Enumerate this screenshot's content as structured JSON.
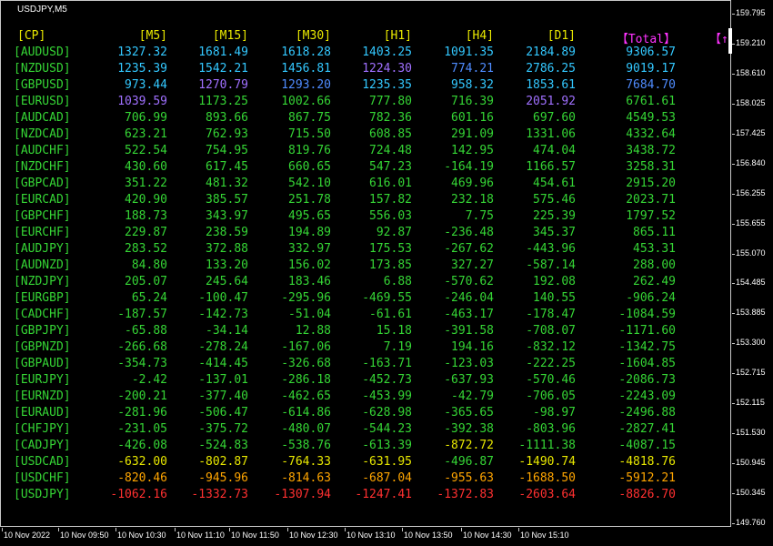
{
  "chart": {
    "title": "USDJPY,M5",
    "price_axis": [
      "159.795",
      "159.210",
      "158.610",
      "158.025",
      "157.425",
      "156.840",
      "156.255",
      "155.655",
      "155.070",
      "154.485",
      "153.885",
      "153.300",
      "152.715",
      "152.115",
      "151.530",
      "150.945",
      "150.345",
      "149.760"
    ],
    "time_axis": [
      "10 Nov 2022",
      "10 Nov 09:50",
      "10 Nov 10:30",
      "10 Nov 11:10",
      "10 Nov 11:50",
      "10 Nov 12:30",
      "10 Nov 13:10",
      "10 Nov 13:50",
      "10 Nov 14:30",
      "10 Nov 15:10"
    ]
  },
  "table": {
    "headers": [
      "[CP]",
      "[M5]",
      "[M15]",
      "[M30]",
      "[H1]",
      "[H4]",
      "[D1]",
      "【Total】",
      "【↑"
    ],
    "header_colors": [
      "#e8e800",
      "#e8e800",
      "#e8e800",
      "#e8e800",
      "#e8e800",
      "#e8e800",
      "#e8e800",
      "#ff33ff",
      "#ff33ff"
    ],
    "rows": [
      {
        "pair": "[AUDUSD]",
        "values": [
          "1327.32",
          "1681.49",
          "1618.28",
          "1403.25",
          "1091.35",
          "2184.89",
          "9306.57"
        ],
        "colors": [
          "#33c8ff",
          "#33c8ff",
          "#33c8ff",
          "#33c8ff",
          "#33c8ff",
          "#33c8ff",
          "#33c8ff"
        ]
      },
      {
        "pair": "[NZDUSD]",
        "values": [
          "1235.39",
          "1542.21",
          "1456.81",
          "1224.30",
          "774.21",
          "2786.25",
          "9019.17"
        ],
        "colors": [
          "#33c8ff",
          "#33c8ff",
          "#33c8ff",
          "#a070ff",
          "#4f8cff",
          "#33c8ff",
          "#33c8ff"
        ]
      },
      {
        "pair": "[GBPUSD]",
        "values": [
          "973.44",
          "1270.79",
          "1293.20",
          "1235.35",
          "958.32",
          "1853.61",
          "7684.70"
        ],
        "colors": [
          "#33c8ff",
          "#a070ff",
          "#4f8cff",
          "#33c8ff",
          "#33c8ff",
          "#33c8ff",
          "#4f8cff"
        ]
      },
      {
        "pair": "[EURUSD]",
        "values": [
          "1039.59",
          "1173.25",
          "1002.66",
          "777.80",
          "716.39",
          "2051.92",
          "6761.61"
        ],
        "colors": [
          "#a070ff",
          "#35d535",
          "#35d535",
          "#35d535",
          "#35d535",
          "#a070ff",
          "#35d535"
        ]
      },
      {
        "pair": "[AUDCAD]",
        "values": [
          "706.99",
          "893.66",
          "867.75",
          "782.36",
          "601.16",
          "697.60",
          "4549.53"
        ],
        "colors": [
          "#35d535",
          "#35d535",
          "#35d535",
          "#35d535",
          "#35d535",
          "#35d535",
          "#35d535"
        ]
      },
      {
        "pair": "[NZDCAD]",
        "values": [
          "623.21",
          "762.93",
          "715.50",
          "608.85",
          "291.09",
          "1331.06",
          "4332.64"
        ],
        "colors": [
          "#35d535",
          "#35d535",
          "#35d535",
          "#35d535",
          "#35d535",
          "#35d535",
          "#35d535"
        ]
      },
      {
        "pair": "[AUDCHF]",
        "values": [
          "522.54",
          "754.95",
          "819.76",
          "724.48",
          "142.95",
          "474.04",
          "3438.72"
        ],
        "colors": [
          "#35d535",
          "#35d535",
          "#35d535",
          "#35d535",
          "#35d535",
          "#35d535",
          "#35d535"
        ]
      },
      {
        "pair": "[NZDCHF]",
        "values": [
          "430.60",
          "617.45",
          "660.65",
          "547.23",
          "-164.19",
          "1166.57",
          "3258.31"
        ],
        "colors": [
          "#35d535",
          "#35d535",
          "#35d535",
          "#35d535",
          "#35d535",
          "#35d535",
          "#35d535"
        ]
      },
      {
        "pair": "[GBPCAD]",
        "values": [
          "351.22",
          "481.32",
          "542.10",
          "616.01",
          "469.96",
          "454.61",
          "2915.20"
        ],
        "colors": [
          "#35d535",
          "#35d535",
          "#35d535",
          "#35d535",
          "#35d535",
          "#35d535",
          "#35d535"
        ]
      },
      {
        "pair": "[EURCAD]",
        "values": [
          "420.90",
          "385.57",
          "251.78",
          "157.82",
          "232.18",
          "575.46",
          "2023.71"
        ],
        "colors": [
          "#35d535",
          "#35d535",
          "#35d535",
          "#35d535",
          "#35d535",
          "#35d535",
          "#35d535"
        ]
      },
      {
        "pair": "[GBPCHF]",
        "values": [
          "188.73",
          "343.97",
          "495.65",
          "556.03",
          "7.75",
          "225.39",
          "1797.52"
        ],
        "colors": [
          "#35d535",
          "#35d535",
          "#35d535",
          "#35d535",
          "#35d535",
          "#35d535",
          "#35d535"
        ]
      },
      {
        "pair": "[EURCHF]",
        "values": [
          "229.87",
          "238.59",
          "194.89",
          "92.87",
          "-236.48",
          "345.37",
          "865.11"
        ],
        "colors": [
          "#35d535",
          "#35d535",
          "#35d535",
          "#35d535",
          "#35d535",
          "#35d535",
          "#35d535"
        ]
      },
      {
        "pair": "[AUDJPY]",
        "values": [
          "283.52",
          "372.88",
          "332.97",
          "175.53",
          "-267.62",
          "-443.96",
          "453.31"
        ],
        "colors": [
          "#35d535",
          "#35d535",
          "#35d535",
          "#35d535",
          "#35d535",
          "#35d535",
          "#35d535"
        ]
      },
      {
        "pair": "[AUDNZD]",
        "values": [
          "84.80",
          "133.20",
          "156.02",
          "173.85",
          "327.27",
          "-587.14",
          "288.00"
        ],
        "colors": [
          "#35d535",
          "#35d535",
          "#35d535",
          "#35d535",
          "#35d535",
          "#35d535",
          "#35d535"
        ]
      },
      {
        "pair": "[NZDJPY]",
        "values": [
          "205.07",
          "245.64",
          "183.46",
          "6.88",
          "-570.62",
          "192.08",
          "262.49"
        ],
        "colors": [
          "#35d535",
          "#35d535",
          "#35d535",
          "#35d535",
          "#35d535",
          "#35d535",
          "#35d535"
        ]
      },
      {
        "pair": "[EURGBP]",
        "values": [
          "65.24",
          "-100.47",
          "-295.96",
          "-469.55",
          "-246.04",
          "140.55",
          "-906.24"
        ],
        "colors": [
          "#35d535",
          "#35d535",
          "#35d535",
          "#35d535",
          "#35d535",
          "#35d535",
          "#35d535"
        ]
      },
      {
        "pair": "[CADCHF]",
        "values": [
          "-187.57",
          "-142.73",
          "-51.04",
          "-61.61",
          "-463.17",
          "-178.47",
          "-1084.59"
        ],
        "colors": [
          "#35d535",
          "#35d535",
          "#35d535",
          "#35d535",
          "#35d535",
          "#35d535",
          "#35d535"
        ]
      },
      {
        "pair": "[GBPJPY]",
        "values": [
          "-65.88",
          "-34.14",
          "12.88",
          "15.18",
          "-391.58",
          "-708.07",
          "-1171.60"
        ],
        "colors": [
          "#35d535",
          "#35d535",
          "#35d535",
          "#35d535",
          "#35d535",
          "#35d535",
          "#35d535"
        ]
      },
      {
        "pair": "[GBPNZD]",
        "values": [
          "-266.68",
          "-278.24",
          "-167.06",
          "7.19",
          "194.16",
          "-832.12",
          "-1342.75"
        ],
        "colors": [
          "#35d535",
          "#35d535",
          "#35d535",
          "#35d535",
          "#35d535",
          "#35d535",
          "#35d535"
        ]
      },
      {
        "pair": "[GBPAUD]",
        "values": [
          "-354.73",
          "-414.45",
          "-326.68",
          "-163.71",
          "-123.03",
          "-222.25",
          "-1604.85"
        ],
        "colors": [
          "#35d535",
          "#35d535",
          "#35d535",
          "#35d535",
          "#35d535",
          "#35d535",
          "#35d535"
        ]
      },
      {
        "pair": "[EURJPY]",
        "values": [
          "-2.42",
          "-137.01",
          "-286.18",
          "-452.73",
          "-637.93",
          "-570.46",
          "-2086.73"
        ],
        "colors": [
          "#35d535",
          "#35d535",
          "#35d535",
          "#35d535",
          "#35d535",
          "#35d535",
          "#35d535"
        ]
      },
      {
        "pair": "[EURNZD]",
        "values": [
          "-200.21",
          "-377.40",
          "-462.65",
          "-453.99",
          "-42.79",
          "-706.05",
          "-2243.09"
        ],
        "colors": [
          "#35d535",
          "#35d535",
          "#35d535",
          "#35d535",
          "#35d535",
          "#35d535",
          "#35d535"
        ]
      },
      {
        "pair": "[EURAUD]",
        "values": [
          "-281.96",
          "-506.47",
          "-614.86",
          "-628.98",
          "-365.65",
          "-98.97",
          "-2496.88"
        ],
        "colors": [
          "#35d535",
          "#35d535",
          "#35d535",
          "#35d535",
          "#35d535",
          "#35d535",
          "#35d535"
        ]
      },
      {
        "pair": "[CHFJPY]",
        "values": [
          "-231.05",
          "-375.72",
          "-480.07",
          "-544.23",
          "-392.38",
          "-803.96",
          "-2827.41"
        ],
        "colors": [
          "#35d535",
          "#35d535",
          "#35d535",
          "#35d535",
          "#35d535",
          "#35d535",
          "#35d535"
        ]
      },
      {
        "pair": "[CADJPY]",
        "values": [
          "-426.08",
          "-524.83",
          "-538.76",
          "-613.39",
          "-872.72",
          "-1111.38",
          "-4087.15"
        ],
        "colors": [
          "#35d535",
          "#35d535",
          "#35d535",
          "#35d535",
          "#e8e800",
          "#35d535",
          "#35d535"
        ]
      },
      {
        "pair": "[USDCAD]",
        "values": [
          "-632.00",
          "-802.87",
          "-764.33",
          "-631.95",
          "-496.87",
          "-1490.74",
          "-4818.76"
        ],
        "colors": [
          "#e8e800",
          "#e8e800",
          "#e8e800",
          "#e8e800",
          "#35d535",
          "#e8e800",
          "#e8e800"
        ]
      },
      {
        "pair": "[USDCHF]",
        "values": [
          "-820.46",
          "-945.96",
          "-814.63",
          "-687.04",
          "-955.63",
          "-1688.50",
          "-5912.21"
        ],
        "colors": [
          "#ffa500",
          "#ffa500",
          "#ffa500",
          "#ffa500",
          "#ffa500",
          "#ffa500",
          "#ffa500"
        ]
      },
      {
        "pair": "[USDJPY]",
        "values": [
          "-1062.16",
          "-1332.73",
          "-1307.94",
          "-1247.41",
          "-1372.83",
          "-2603.64",
          "-8826.70"
        ],
        "colors": [
          "#ff3030",
          "#ff3030",
          "#ff3030",
          "#ff3030",
          "#ff3030",
          "#ff3030",
          "#ff3030"
        ]
      }
    ]
  }
}
